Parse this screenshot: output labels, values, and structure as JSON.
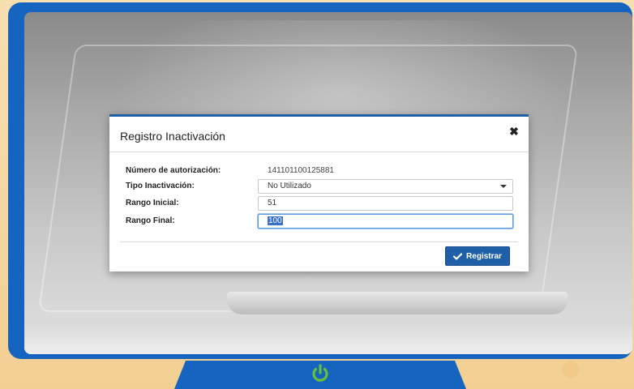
{
  "modal": {
    "title": "Registro Inactivación",
    "close_icon": "close-icon",
    "fields": {
      "authorization": {
        "label": "Número de autorización:",
        "value": "141101100125881"
      },
      "type": {
        "label": "Tipo Inactivación:",
        "value": "No Utilizado"
      },
      "range_start": {
        "label": "Rango Inicial:",
        "value": "51"
      },
      "range_end": {
        "label": "Rango Final:",
        "value": "100"
      }
    },
    "register_button": {
      "label": "Registrar",
      "icon": "check-icon"
    }
  },
  "device": {
    "power_icon": "power-icon",
    "frame_color": "#1565c0",
    "power_color": "#6abf3a"
  }
}
